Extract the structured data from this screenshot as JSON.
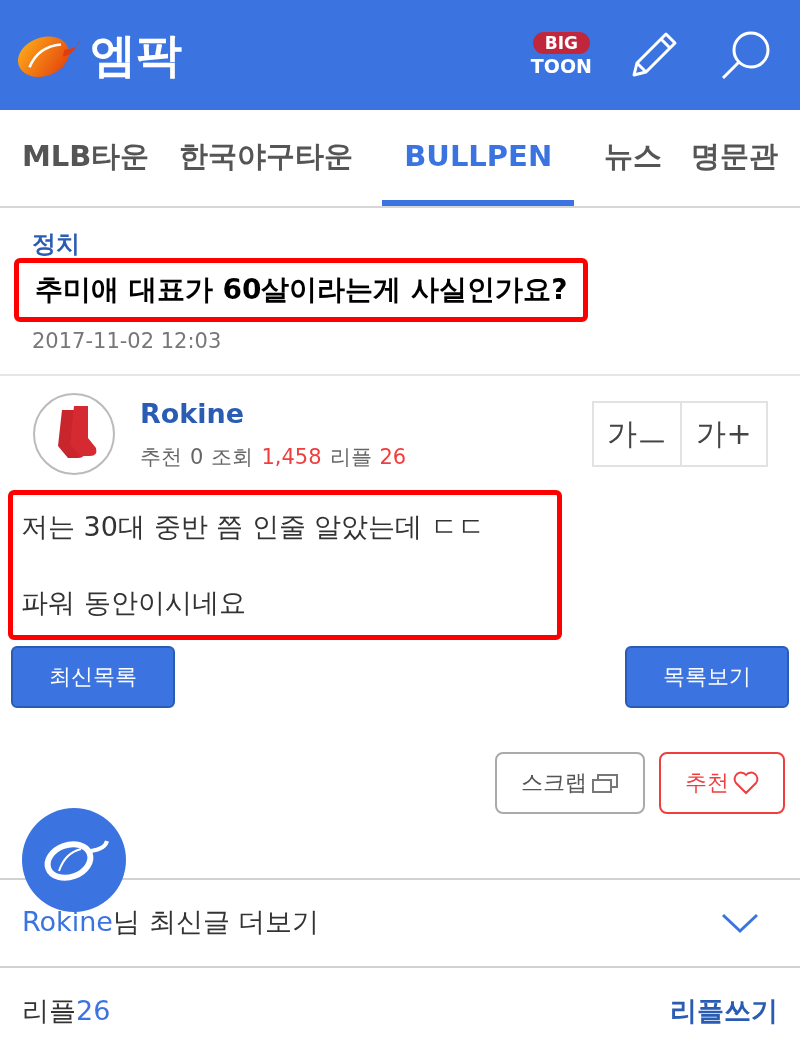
{
  "header": {
    "logo_text": "엠팍",
    "bigtoon": {
      "top": "BIG",
      "bottom": "TOON"
    }
  },
  "tabs": [
    {
      "label": "MLB타운",
      "selected": false
    },
    {
      "label": "한국야구타운",
      "selected": false
    },
    {
      "label": "BULLPEN",
      "selected": true
    },
    {
      "label": "뉴스",
      "selected": false
    },
    {
      "label": "명문관",
      "selected": false
    }
  ],
  "post": {
    "category": "정치",
    "title": "추미애 대표가 60살이라는게 사실인가요?",
    "title_highlighted": true,
    "date": "2017-11-02 12:03",
    "author": "Rokine",
    "stats": [
      {
        "label": "추천",
        "value": "0",
        "accent": false
      },
      {
        "label": "조회",
        "value": "1,458",
        "accent": true
      },
      {
        "label": "리플",
        "value": "26",
        "accent": true
      }
    ],
    "font_buttons": [
      "가ㅡ",
      "가+"
    ],
    "body": [
      "저는 30대 중반 쯤 인줄 알았는데 ㄷㄷ",
      "파워 동안이시네요"
    ],
    "body_highlighted": true
  },
  "nav_buttons": [
    "최신목록",
    "목록보기"
  ],
  "actions": {
    "scrap": "스크랩",
    "recommend": "추천"
  },
  "more_posts": {
    "name": "Rokine",
    "text": "님 최신글 더보기",
    "expanded": false
  },
  "replies": {
    "label": "리플",
    "count": "26",
    "write": "리플쓰기"
  }
}
